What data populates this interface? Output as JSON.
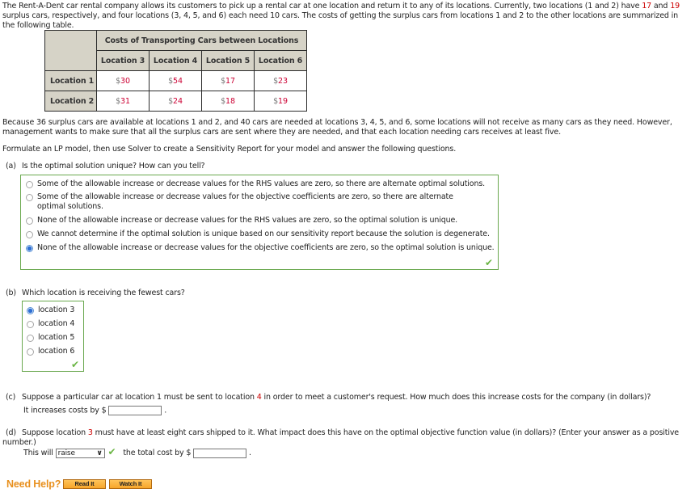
{
  "intro": {
    "part1": "The Rent-A-Dent car rental company allows its customers to pick up a rental car at one location and return it to any of its locations. Currently, two locations (1 and 2) have ",
    "surplus1": "17",
    "and": " and ",
    "surplus2": "19",
    "part2": " surplus cars, respectively, and four locations (3, 4, 5, and 6) each need 10 cars. The costs of getting the surplus cars from locations 1 and 2 to the other locations are summarized in the following table."
  },
  "table": {
    "title": "Costs of Transporting Cars between Locations",
    "columns": [
      "Location 3",
      "Location 4",
      "Location 5",
      "Location 6"
    ],
    "currency": "$",
    "rows": [
      {
        "label": "Location 1",
        "values": [
          "30",
          "54",
          "17",
          "23"
        ]
      },
      {
        "label": "Location 2",
        "values": [
          "31",
          "24",
          "18",
          "19"
        ]
      }
    ]
  },
  "context": {
    "para1": "Because 36 surplus cars are available at locations 1 and 2, and 40 cars are needed at locations 3, 4, 5, and 6, some locations will not receive as many cars as they need. However, management wants to make sure that all the surplus cars are sent where they are needed, and that each location needing cars receives at least five.",
    "para2": "Formulate an LP model, then use Solver to create a Sensitivity Report for your model and answer the following questions."
  },
  "questions": {
    "a": {
      "label": "(a)",
      "text": "Is the optimal solution unique? How can you tell?",
      "options": [
        {
          "text": "Some of the allowable increase or decrease values for the RHS values are zero, so there are alternate optimal solutions.",
          "selected": false
        },
        {
          "text": "Some of the allowable increase or decrease values for the objective coefficients are zero, so there are alternate optimal solutions.",
          "selected": false
        },
        {
          "text": "None of the allowable increase or decrease values for the RHS values are zero, so the optimal solution is unique.",
          "selected": false
        },
        {
          "text": "We cannot determine if the optimal solution is unique based on our sensitivity report because the solution is degenerate.",
          "selected": false
        },
        {
          "text": "None of the allowable increase or decrease values for the objective coefficients are zero, so the optimal solution is unique.",
          "selected": true
        }
      ],
      "status": "correct"
    },
    "b": {
      "label": "(b)",
      "text": "Which location is receiving the fewest cars?",
      "options": [
        {
          "text": "location 3",
          "selected": true
        },
        {
          "text": "location 4",
          "selected": false
        },
        {
          "text": "location 5",
          "selected": false
        },
        {
          "text": "location 6",
          "selected": false
        }
      ],
      "status": "correct"
    },
    "c": {
      "label": "(c)",
      "text_pre": "Suppose a particular car at location 1 must be sent to location ",
      "highlight": "4",
      "text_post": " in order to meet a customer's request. How much does this increase costs for the company (in dollars)?",
      "answer_prefix": "It increases costs by $",
      "answer_value": "",
      "answer_suffix": "."
    },
    "d": {
      "label": "(d)",
      "text_pre": "Suppose location ",
      "highlight": "3",
      "text_post": " must have at least eight cars shipped to it. What impact does this have on the optimal objective function value (in dollars)? (Enter your answer as a positive number.)",
      "answer_prefix": "This will",
      "select_value": "raise",
      "select_status": "correct",
      "answer_mid": "the total cost by $",
      "answer_value": "",
      "answer_suffix": "."
    }
  },
  "help": {
    "label": "Need Help?",
    "read_button": "Read It",
    "watch_button": "Watch It"
  },
  "colors": {
    "highlight": "#cc0000",
    "correct": "#6bb544",
    "box_border": "#6aa84f",
    "help_accent": "#e8901e"
  }
}
